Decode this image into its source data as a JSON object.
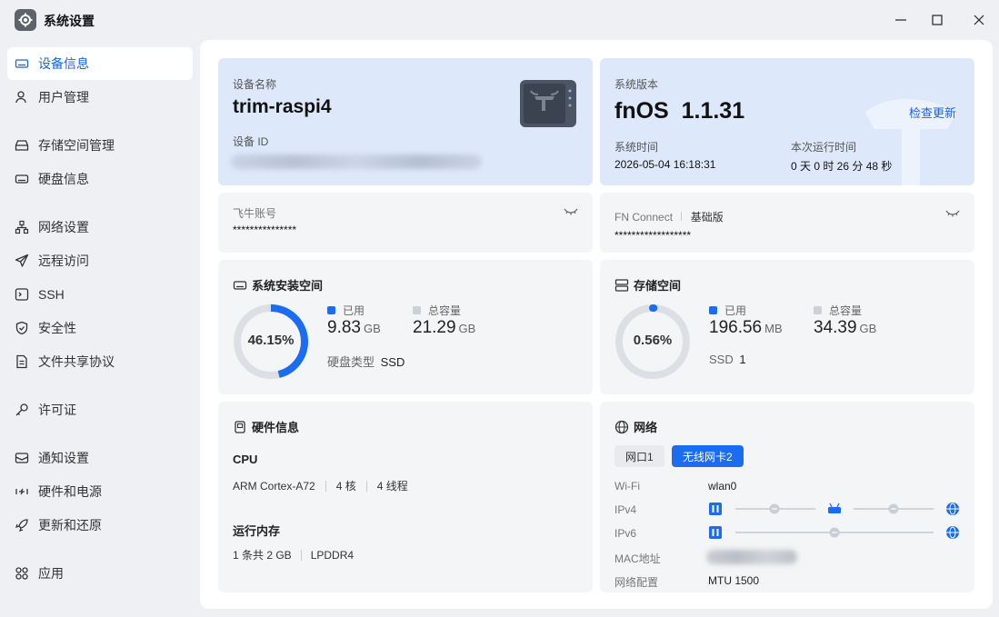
{
  "window": {
    "title": "系统设置",
    "icons": {
      "app": "gear-icon",
      "minimize": "minimize-icon",
      "maximize": "maximize-icon",
      "close": "close-icon"
    }
  },
  "sidebar": {
    "items": [
      {
        "label": "设备信息",
        "icon": "device-icon",
        "active": true
      },
      {
        "label": "用户管理",
        "icon": "user-icon"
      },
      {
        "label": "存储空间管理",
        "icon": "storage-icon"
      },
      {
        "label": "硬盘信息",
        "icon": "disk-icon"
      },
      {
        "label": "网络设置",
        "icon": "network-icon"
      },
      {
        "label": "远程访问",
        "icon": "send-icon"
      },
      {
        "label": "SSH",
        "icon": "terminal-icon"
      },
      {
        "label": "安全性",
        "icon": "shield-icon"
      },
      {
        "label": "文件共享协议",
        "icon": "file-icon"
      },
      {
        "label": "许可证",
        "icon": "key-icon"
      },
      {
        "label": "通知设置",
        "icon": "mail-icon"
      },
      {
        "label": "硬件和电源",
        "icon": "power-icon"
      },
      {
        "label": "更新和还原",
        "icon": "rocket-icon"
      },
      {
        "label": "应用",
        "icon": "apps-icon"
      }
    ]
  },
  "device": {
    "name_label": "设备名称",
    "name": "trim-raspi4",
    "id_label": "设备 ID"
  },
  "system": {
    "version_label": "系统版本",
    "version": "fnOS  1.1.31",
    "check_update": "检查更新",
    "time_label": "系统时间",
    "time": "2026-05-04 16:18:31",
    "uptime_label": "本次运行时间",
    "uptime": "0 天 0 时 26 分 48 秒"
  },
  "account": {
    "label": "飞牛账号",
    "value": "***************",
    "eye_icon": "eye-closed-icon"
  },
  "fnconnect": {
    "label": "FN Connect",
    "plan": "基础版",
    "value": "******************",
    "eye_icon": "eye-closed-icon"
  },
  "system_space": {
    "title": "系统安装空间",
    "percent": "46.15%",
    "percent_value": 46.15,
    "used_label": "已用",
    "used_value": "9.83",
    "used_unit": "GB",
    "total_label": "总容量",
    "total_value": "21.29",
    "total_unit": "GB",
    "disk_type_label": "硬盘类型",
    "disk_type": "SSD"
  },
  "storage_space": {
    "title": "存储空间",
    "percent": "0.56%",
    "percent_value": 0.56,
    "used_label": "已用",
    "used_value": "196.56",
    "used_unit": "MB",
    "total_label": "总容量",
    "total_value": "34.39",
    "total_unit": "GB",
    "ssd_label": "SSD",
    "ssd_count": "1"
  },
  "hardware": {
    "title": "硬件信息",
    "cpu_label": "CPU",
    "cpu_model": "ARM Cortex-A72",
    "cpu_cores": "4 核",
    "cpu_threads": "4 线程",
    "mem_label": "运行内存",
    "mem_size": "1 条共 2 GB",
    "mem_type": "LPDDR4"
  },
  "network": {
    "title": "网络",
    "tabs": [
      "网口1",
      "无线网卡2"
    ],
    "active_tab": 1,
    "wifi_label": "Wi-Fi",
    "wifi_value": "wlan0",
    "ipv4_label": "IPv4",
    "ipv6_label": "IPv6",
    "mac_label": "MAC地址",
    "config_label": "网络配置",
    "config_value": "MTU 1500"
  },
  "colors": {
    "accent": "#1b6cf0",
    "gauge_track": "#dcdfe4",
    "used_legend": "#1b6cf0",
    "total_legend": "#cdd0d5"
  }
}
